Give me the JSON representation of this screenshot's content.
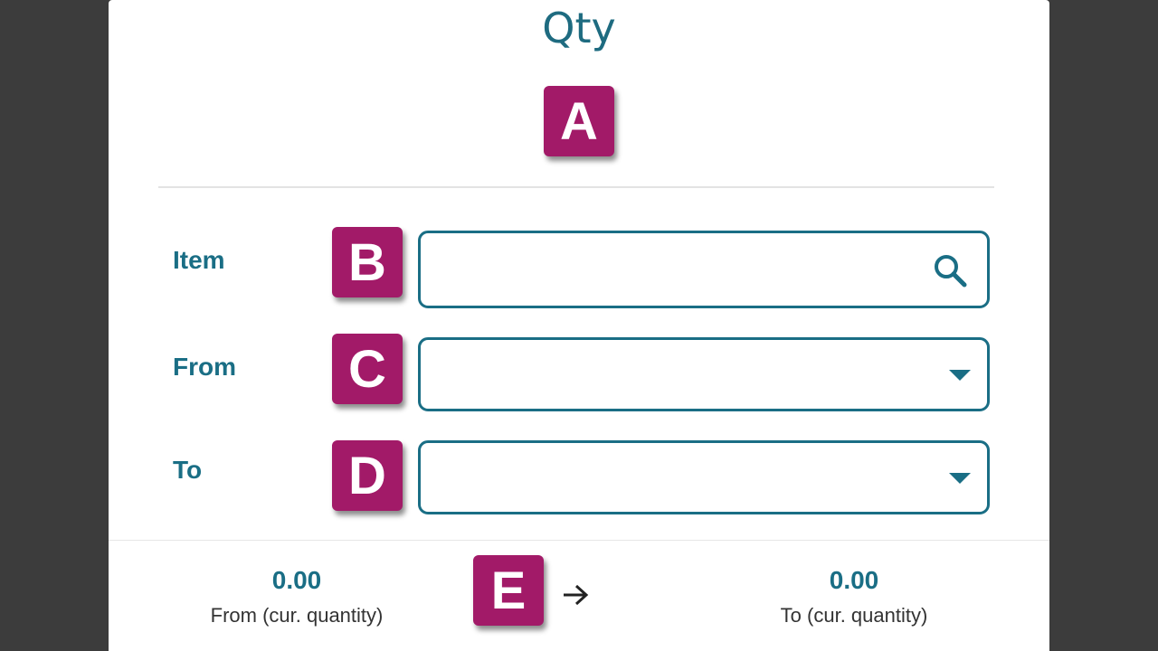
{
  "header": {
    "title": "Qty"
  },
  "form": {
    "item": {
      "label": "Item",
      "value": "",
      "icon": "search-icon"
    },
    "from": {
      "label": "From",
      "value": "",
      "icon": "chevron-down-icon"
    },
    "to": {
      "label": "To",
      "value": "",
      "icon": "chevron-down-icon"
    }
  },
  "badges": {
    "a": "A",
    "b": "B",
    "c": "C",
    "d": "D",
    "e": "E"
  },
  "footer": {
    "from_value": "0.00",
    "from_caption": "From (cur. quantity)",
    "to_value": "0.00",
    "to_caption": "To (cur. quantity)",
    "arrow_icon": "arrow-right-icon"
  },
  "colors": {
    "accent": "#1a6e85",
    "badge": "#a21a68",
    "backdrop": "#3c3c3c"
  }
}
